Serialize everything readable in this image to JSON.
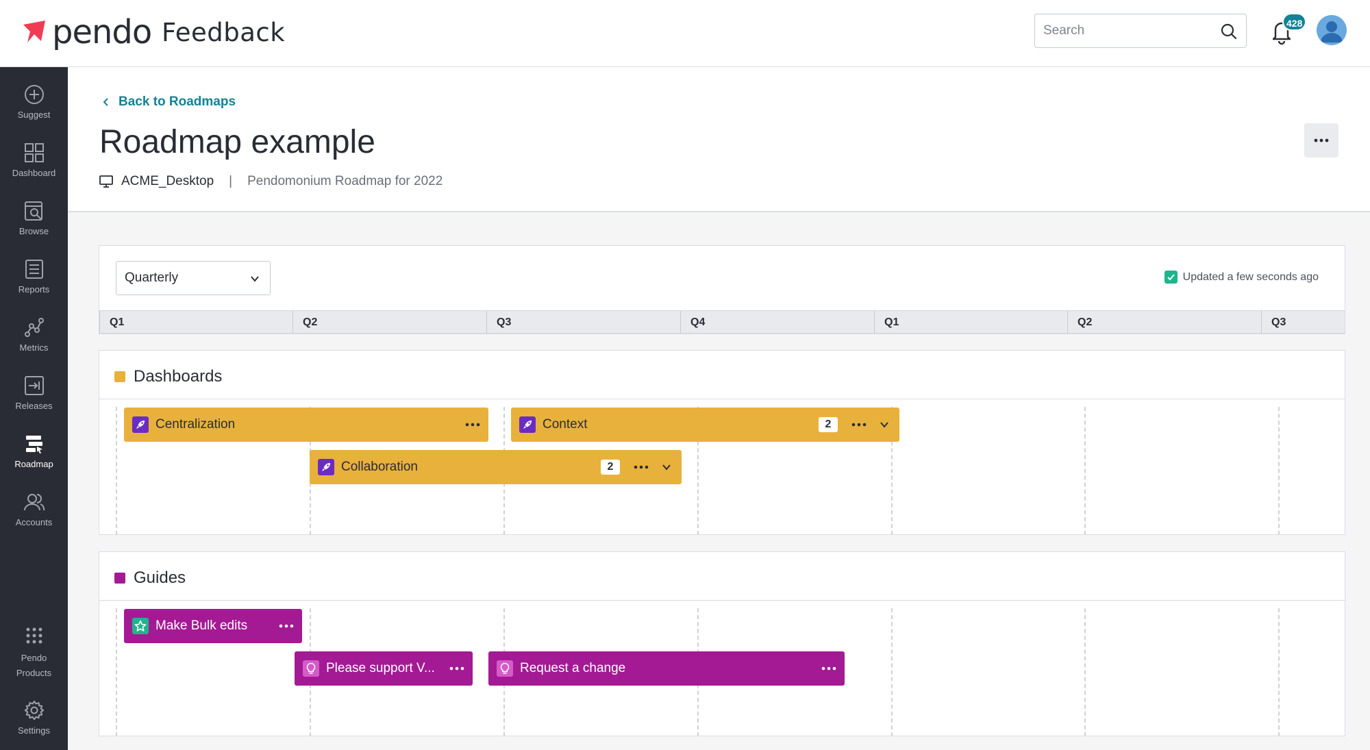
{
  "app": {
    "logo_text": "pendo",
    "product_name": "Feedback"
  },
  "colors": {
    "brand": "#ef3c54",
    "accent": "#128297",
    "dashboards": "#e8b13b",
    "guides": "#a31a94",
    "sidebar": "#2a2c35"
  },
  "header": {
    "search_placeholder": "Search",
    "notification_count": "428"
  },
  "sidebar": {
    "items": [
      {
        "label": "Suggest",
        "icon": "plus-circle-icon"
      },
      {
        "label": "Dashboard",
        "icon": "grid-icon"
      },
      {
        "label": "Browse",
        "icon": "browse-icon"
      },
      {
        "label": "Reports",
        "icon": "reports-icon"
      },
      {
        "label": "Metrics",
        "icon": "metrics-icon"
      },
      {
        "label": "Releases",
        "icon": "releases-icon"
      },
      {
        "label": "Roadmap",
        "icon": "roadmap-icon"
      },
      {
        "label": "Accounts",
        "icon": "accounts-icon"
      }
    ],
    "products_label": "Pendo Products",
    "settings_label": "Settings"
  },
  "page": {
    "back_label": "Back to Roadmaps",
    "title": "Roadmap example",
    "app_name": "ACME_Desktop",
    "separator": "|",
    "description": "Pendomonium Roadmap for 2022"
  },
  "timeline": {
    "view_selected": "Quarterly",
    "updated_text": "Updated a few seconds ago",
    "quarters": [
      "Q1",
      "Q2",
      "Q3",
      "Q4",
      "Q1",
      "Q2",
      "Q3"
    ]
  },
  "groups": [
    {
      "title": "Dashboards",
      "items": [
        {
          "label": "Centralization",
          "icon": "rocket-icon"
        },
        {
          "label": "Context",
          "icon": "rocket-icon",
          "count": "2"
        },
        {
          "label": "Collaboration",
          "icon": "rocket-icon",
          "count": "2"
        }
      ]
    },
    {
      "title": "Guides",
      "items": [
        {
          "label": "Make Bulk edits",
          "icon": "star-icon"
        },
        {
          "label": "Please support V...",
          "icon": "bulb-icon"
        },
        {
          "label": "Request a change",
          "icon": "bulb-icon"
        }
      ]
    }
  ]
}
